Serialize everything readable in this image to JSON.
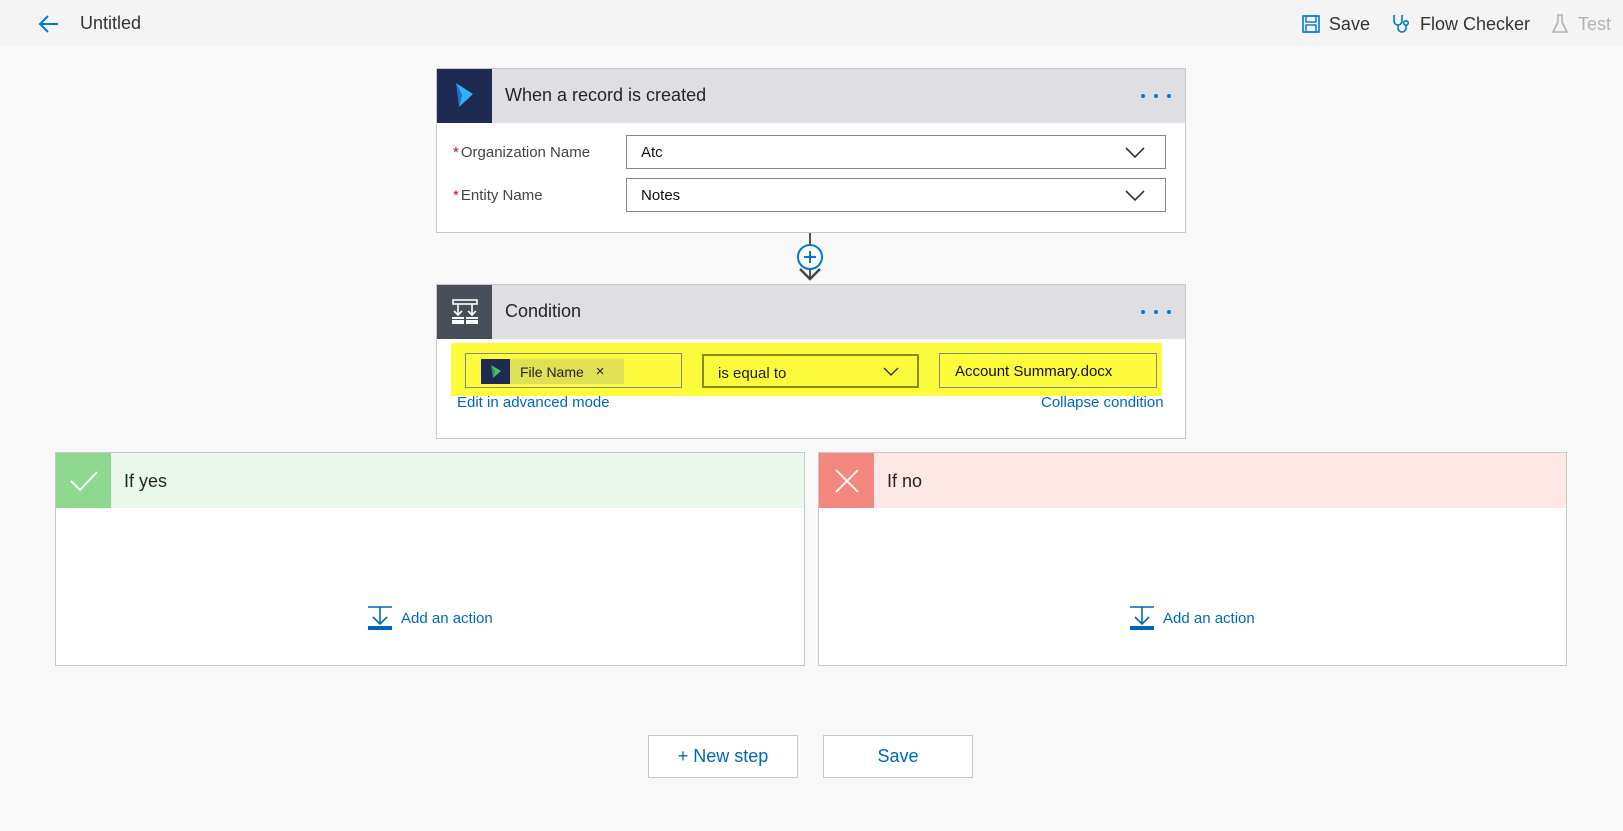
{
  "header": {
    "title": "Untitled",
    "actions": [
      {
        "label": "Save",
        "icon": "save-icon"
      },
      {
        "label": "Flow Checker",
        "icon": "stethoscope-icon"
      },
      {
        "label": "Test",
        "icon": "flask-icon"
      }
    ]
  },
  "trigger": {
    "title": "When a record is created",
    "icon": "dynamics-icon",
    "fields": [
      {
        "label": "Organization Name",
        "required": "*",
        "value": "Atc"
      },
      {
        "label": "Entity Name",
        "required": "*",
        "value": "Notes"
      }
    ]
  },
  "condition": {
    "title": "Condition",
    "icon": "condition-icon",
    "left_token": "File Name",
    "token_remove": "×",
    "operator": "is equal to",
    "value": "Account Summary.docx",
    "advanced_link": "Edit in advanced mode",
    "collapse_link": "Collapse condition"
  },
  "branches": {
    "yes": {
      "title": "If yes",
      "add_action": "Add an action",
      "color": "#8fd88f",
      "head_color": "#e9f8ea"
    },
    "no": {
      "title": "If no",
      "add_action": "Add an action",
      "color": "#f4877f",
      "head_color": "#fde8e6"
    }
  },
  "footer": {
    "new_step": "+ New step",
    "save": "Save"
  },
  "colors": {
    "accent": "#0078d4",
    "highlight": "#fcfc3c",
    "dynamics_bg": "#1e2a52",
    "condition_bg": "#484f58"
  }
}
